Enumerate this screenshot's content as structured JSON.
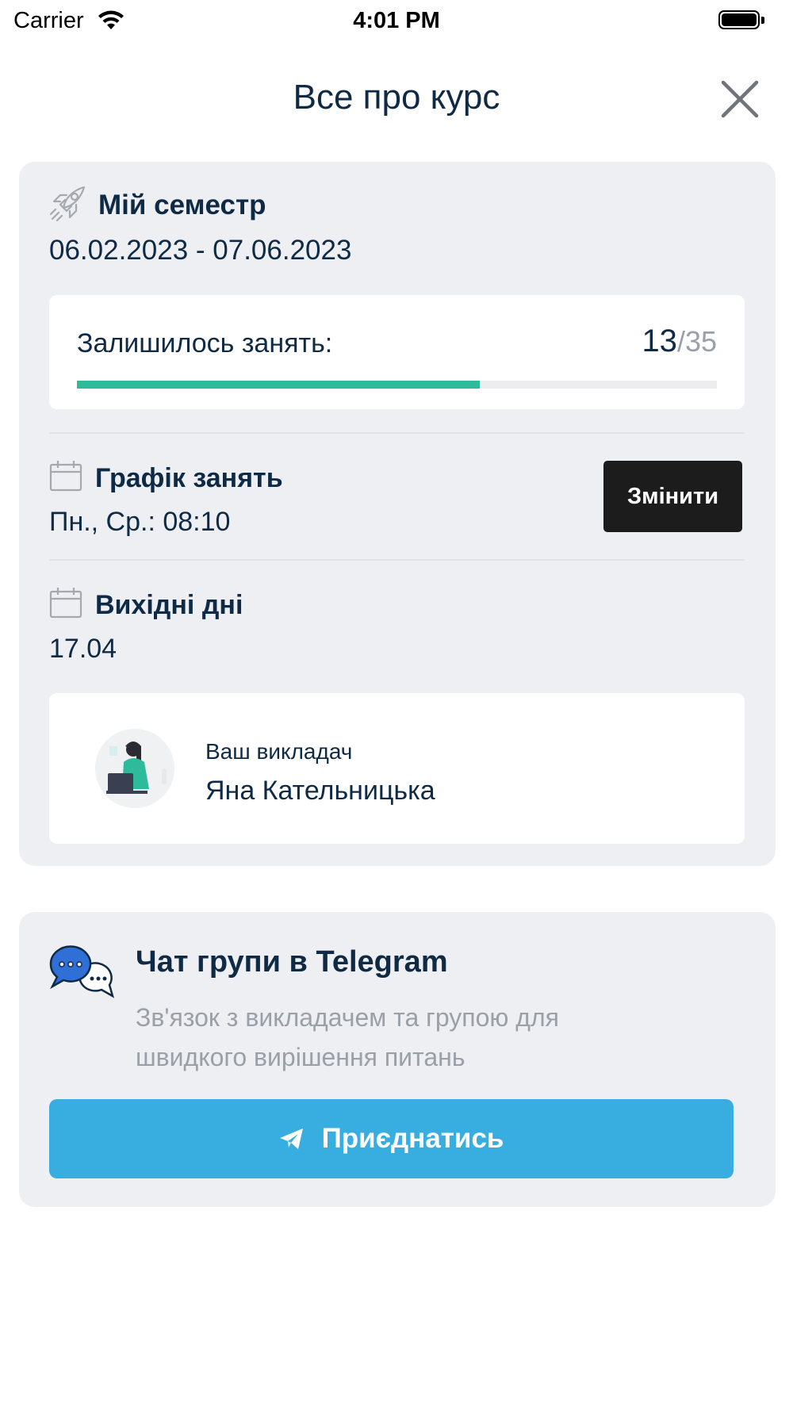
{
  "status_bar": {
    "carrier": "Carrier",
    "time": "4:01 PM"
  },
  "header": {
    "title": "Все про курс",
    "close_icon": "close-icon"
  },
  "semester": {
    "icon": "rocket-icon",
    "title": "Мій семестр",
    "dates": "06.02.2023 - 07.06.2023"
  },
  "lessons": {
    "label": "Залишилось занять:",
    "remaining": "13",
    "separator": "/",
    "total": "35",
    "progress_fraction": 0.63,
    "progress_color": "#2dbb9c"
  },
  "schedule": {
    "icon": "calendar-icon",
    "title": "Графік занять",
    "value": "Пн., Ср.: 08:10",
    "change_label": "Змінити"
  },
  "holidays": {
    "icon": "calendar-icon",
    "title": "Вихідні дні",
    "value": "17.04"
  },
  "teacher": {
    "role": "Ваш викладач",
    "name": "Яна Кательницька"
  },
  "telegram": {
    "icon": "chat-bubbles-icon",
    "title": "Чат групи в Telegram",
    "description": "Зв'язок з викладачем та групою для швидкого вирішення питань",
    "join_label": "Приєднатись",
    "button_color": "#38ade0"
  }
}
